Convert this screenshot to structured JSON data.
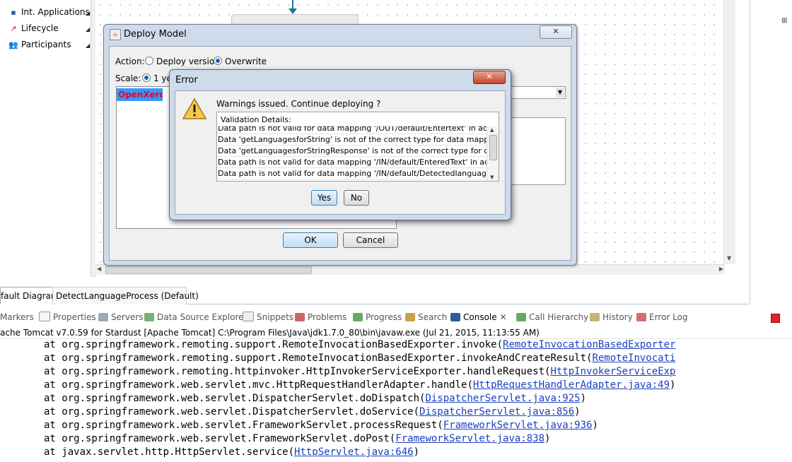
{
  "palette": {
    "items": [
      {
        "label": "Int. Applications",
        "icon": "applications-icon"
      },
      {
        "label": "Lifecycle",
        "icon": "lifecycle-icon"
      },
      {
        "label": "Participants",
        "icon": "participants-icon"
      }
    ]
  },
  "editor_tabs": [
    "fault Diagram",
    "DetectLanguageProcess (Default)"
  ],
  "views": {
    "tabs": [
      "Markers",
      "Properties",
      "Servers",
      "Data Source Explorer",
      "Snippets",
      "Problems",
      "Progress",
      "Search",
      "Console",
      "Call Hierarchy",
      "History",
      "Error Log"
    ],
    "active": "Console",
    "close_glyph": "✕"
  },
  "console": {
    "header": "ache Tomcat v7.0.59 for Stardust [Apache Tomcat] C:\\Program Files\\Java\\jdk1.7.0_80\\bin\\javaw.exe (Jul 21, 2015, 11:13:55 AM)",
    "lines": [
      {
        "text": "at org.springframework.remoting.support.RemoteInvocationBasedExporter.invoke(",
        "link": "RemoteInvocationBasedExporter"
      },
      {
        "text": "at org.springframework.remoting.support.RemoteInvocationBasedExporter.invokeAndCreateResult(",
        "link": "RemoteInvocati"
      },
      {
        "text": "at org.springframework.remoting.httpinvoker.HttpInvokerServiceExporter.handleRequest(",
        "link": "HttpInvokerServiceExp"
      },
      {
        "text": "at org.springframework.web.servlet.mvc.HttpRequestHandlerAdapter.handle(",
        "link": "HttpRequestHandlerAdapter.java:49",
        "tail": ")"
      },
      {
        "text": "at org.springframework.web.servlet.DispatcherServlet.doDispatch(",
        "link": "DispatcherServlet.java:925",
        "tail": ")"
      },
      {
        "text": "at org.springframework.web.servlet.DispatcherServlet.doService(",
        "link": "DispatcherServlet.java:856",
        "tail": ")"
      },
      {
        "text": "at org.springframework.web.servlet.FrameworkServlet.processRequest(",
        "link": "FrameworkServlet.java:936",
        "tail": ")"
      },
      {
        "text": "at org.springframework.web.servlet.FrameworkServlet.doPost(",
        "link": "FrameworkServlet.java:838",
        "tail": ")"
      },
      {
        "text": "at javax.servlet.http.HttpServlet.service(",
        "link": "HttpServlet.java:646",
        "tail": ")"
      }
    ]
  },
  "deploy_dialog": {
    "title": "Deploy Model",
    "action_label": "Action:",
    "deploy_version": "Deploy version",
    "overwrite": "Overwrite",
    "scale_label": "Scale:",
    "scale_option": "1 ye",
    "list_selected": "OpenXeroxS",
    "ok": "OK",
    "cancel": "Cancel",
    "close_glyph": "✕"
  },
  "error_dialog": {
    "title": "Error",
    "close_glyph": "✕",
    "message": "Warnings issued. Continue deploying ?",
    "details_header": "Validation Details:",
    "rows": [
      "Data path is not valid for data mapping '/OUT/default/Entertext' in activit...",
      "Data 'getLanguagesforString' is not of the correct type for data mapping '/I...",
      "Data 'getLanguagesforStringResponse' is not of the correct type for data m...",
      "Data path is not valid for data mapping '/IN/default/EnteredText' in activity '...",
      "Data path is not valid for data mapping '/IN/default/Detectedlanguage' in ac..."
    ],
    "yes": "Yes",
    "no": "No"
  },
  "colors": {
    "accent": "#3399ff",
    "link": "#1a3fc0",
    "list_text": "#e8002a",
    "error_close": "#c5472d"
  }
}
